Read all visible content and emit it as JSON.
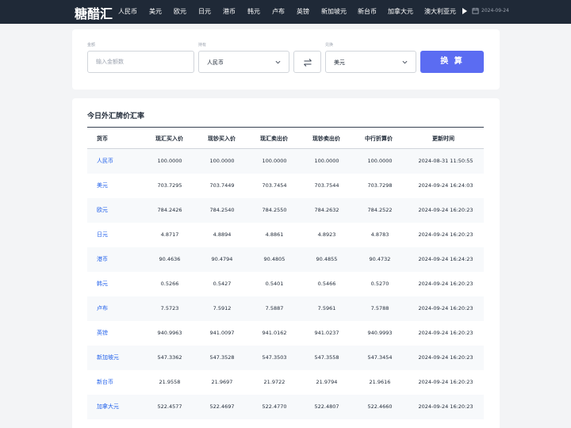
{
  "nav": {
    "logo": "糖醋汇",
    "items": [
      "人民币",
      "美元",
      "欧元",
      "日元",
      "港币",
      "韩元",
      "卢布",
      "英镑",
      "新加坡元",
      "新台币",
      "加拿大元",
      "澳大利亚元"
    ],
    "date": "2024-09-24",
    "date_icon": "calendar-icon",
    "more_icon": "play-arrow-icon"
  },
  "converter": {
    "amount_label": "金额",
    "amount_placeholder": "输入金额数",
    "from_label": "持有",
    "from_value": "人民币",
    "to_label": "兑换",
    "to_value": "美元",
    "swap_icon": "swap-icon",
    "convert_button": "换 算",
    "accent_color": "#5b6cf2"
  },
  "rates": {
    "title": "今日外汇牌价汇率",
    "columns": [
      "货币",
      "现汇买入价",
      "现钞买入价",
      "现汇卖出价",
      "现钞卖出价",
      "中行折算价",
      "更新时间"
    ],
    "rows": [
      [
        "人民币",
        "100.0000",
        "100.0000",
        "100.0000",
        "100.0000",
        "100.0000",
        "2024-08-31 11:50:55"
      ],
      [
        "美元",
        "703.7295",
        "703.7449",
        "703.7454",
        "703.7544",
        "703.7298",
        "2024-09-24 16:24:03"
      ],
      [
        "欧元",
        "784.2426",
        "784.2540",
        "784.2550",
        "784.2632",
        "784.2522",
        "2024-09-24 16:20:23"
      ],
      [
        "日元",
        "4.8717",
        "4.8894",
        "4.8861",
        "4.8923",
        "4.8783",
        "2024-09-24 16:20:23"
      ],
      [
        "港币",
        "90.4636",
        "90.4794",
        "90.4805",
        "90.4855",
        "90.4732",
        "2024-09-24 16:24:23"
      ],
      [
        "韩元",
        "0.5266",
        "0.5427",
        "0.5401",
        "0.5466",
        "0.5270",
        "2024-09-24 16:20:23"
      ],
      [
        "卢布",
        "7.5723",
        "7.5912",
        "7.5887",
        "7.5961",
        "7.5788",
        "2024-09-24 16:20:23"
      ],
      [
        "英镑",
        "940.9963",
        "941.0097",
        "941.0162",
        "941.0237",
        "940.9993",
        "2024-09-24 16:20:23"
      ],
      [
        "新加坡元",
        "547.3362",
        "547.3528",
        "547.3503",
        "547.3558",
        "547.3454",
        "2024-09-24 16:20:23"
      ],
      [
        "新台币",
        "21.9558",
        "21.9697",
        "21.9722",
        "21.9794",
        "21.9616",
        "2024-09-24 16:20:23"
      ],
      [
        "加拿大元",
        "522.4577",
        "522.4697",
        "522.4770",
        "522.4807",
        "522.4660",
        "2024-09-24 16:20:23"
      ]
    ]
  }
}
